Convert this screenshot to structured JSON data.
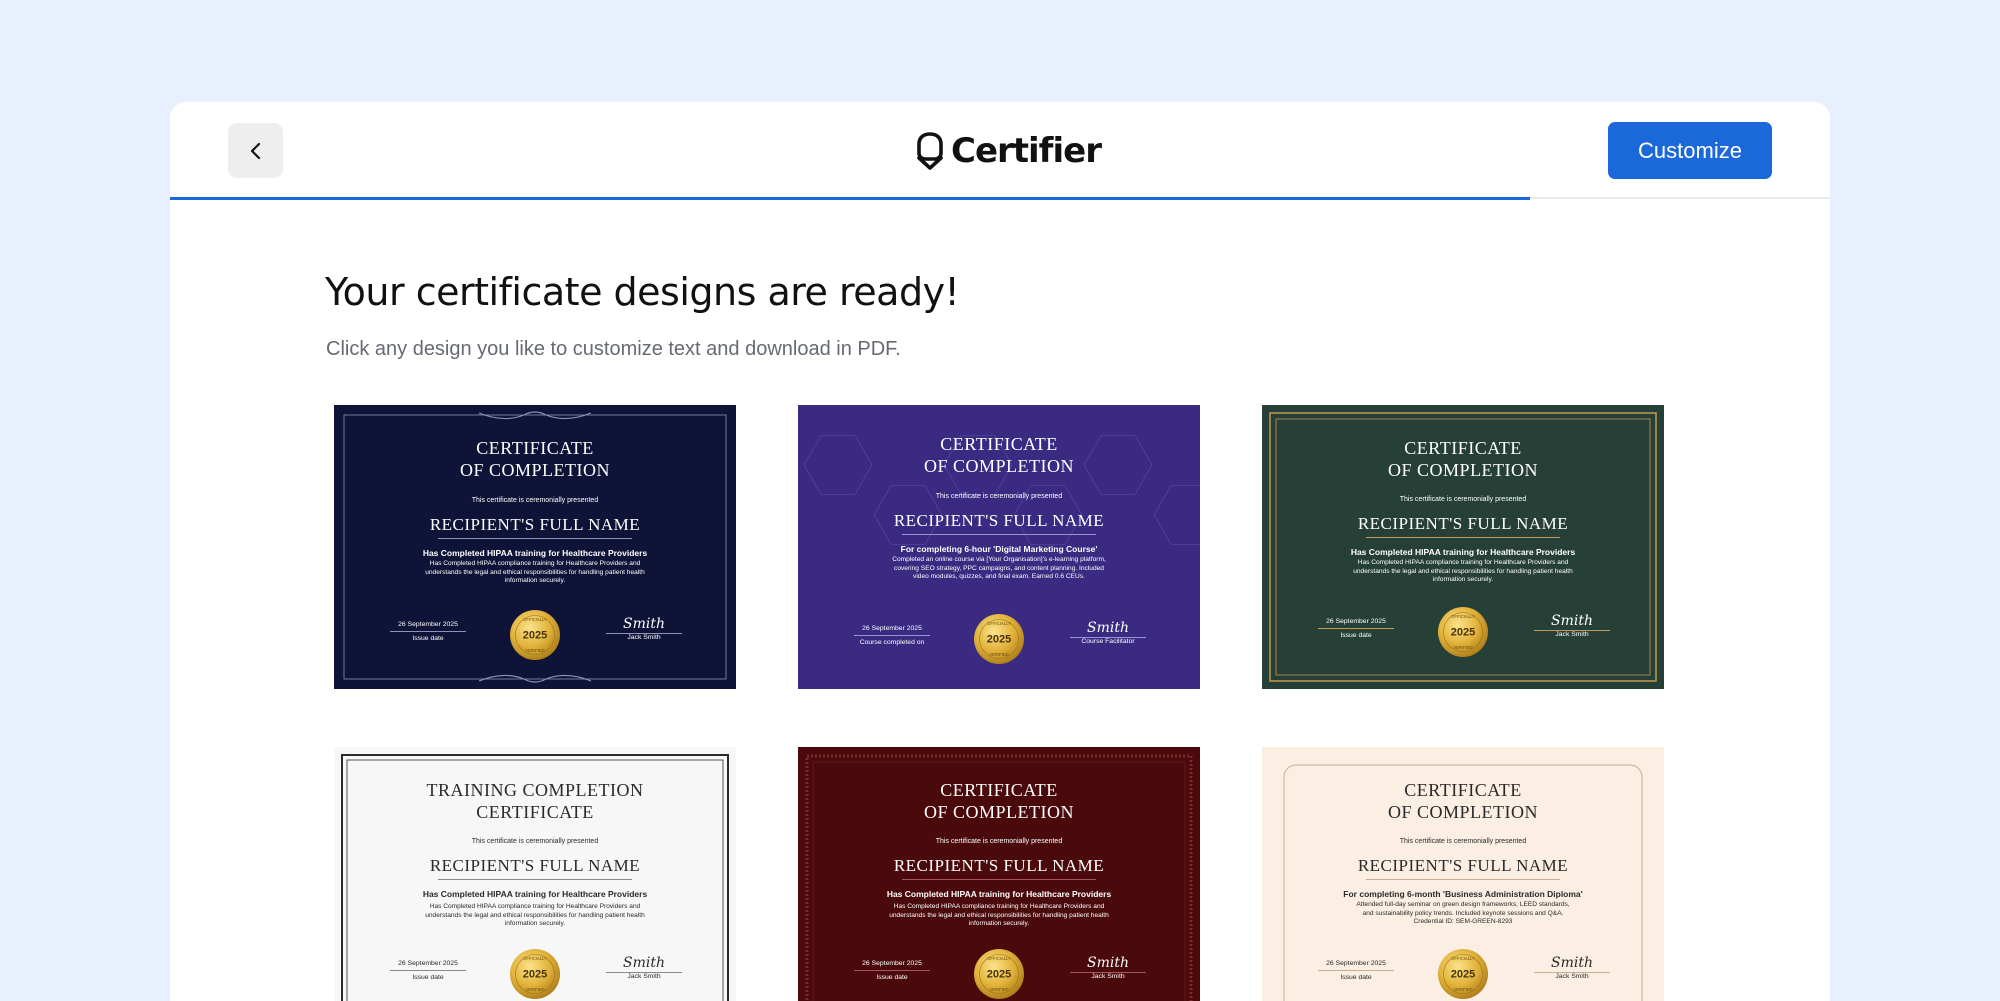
{
  "header": {
    "back_icon": "chevron-left-icon",
    "logo_icon": "certifier-shield-icon",
    "logo_text": "Certifier",
    "customize_label": "Customize",
    "progress_fraction": 0.819
  },
  "main": {
    "title": "Your certificate designs are ready!",
    "subtitle": "Click any design you like to customize text and download in PDF."
  },
  "seal": {
    "top_text": "OFFICIALLY",
    "year": "2025",
    "bottom_text": "VERIFIED"
  },
  "certificates": [
    {
      "title_line1": "CERTIFICATE",
      "title_line2": "OF COMPLETION",
      "presented": "This certificate is ceremonially presented",
      "name": "RECIPIENT'S FULL NAME",
      "course": "Has Completed HIPAA training for Healthcare Providers",
      "description": "Has Completed HIPAA compliance training for Healthcare Providers and understands the legal and ethical responsibilities for handling patient health information securely.",
      "date": "26 September 2025",
      "date_label": "Issue date",
      "signature": "Smith",
      "signer": "Jack Smith",
      "background": "#0f1338",
      "text_color": "#ffffff",
      "accent": "#8d92b8"
    },
    {
      "title_line1": "CERTIFICATE",
      "title_line2": "OF COMPLETION",
      "presented": "This certificate is ceremonially presented",
      "name": "RECIPIENT'S FULL NAME",
      "course": "For completing 6-hour 'Digital Marketing Course'",
      "description": "Completed an online course via [Your Organisation]'s e-learning platform, covering SEO strategy, PPC campaigns, and content planning. Included video modules, quizzes, and final exam. Earned 0.6 CEUs.",
      "date": "26 September 2025",
      "date_label": "Course completed on",
      "signature": "Smith",
      "signer": "Course Facilitator",
      "background": "#3a2a82",
      "text_color": "#ffffff",
      "accent": "#9c90d6"
    },
    {
      "title_line1": "CERTIFICATE",
      "title_line2": "OF COMPLETION",
      "presented": "This certificate is ceremonially presented",
      "name": "RECIPIENT'S FULL NAME",
      "course": "Has Completed HIPAA training for Healthcare Providers",
      "description": "Has Completed HIPAA compliance training for Healthcare Providers and understands the legal and ethical responsibilities for handling patient health information securely.",
      "date": "26 September 2025",
      "date_label": "Issue date",
      "signature": "Smith",
      "signer": "Jack Smith",
      "background": "#263f37",
      "text_color": "#ffffff",
      "accent": "#c49a52"
    },
    {
      "title_line1": "TRAINING COMPLETION",
      "title_line2": "CERTIFICATE",
      "presented": "This certificate is ceremonially presented",
      "name": "RECIPIENT'S FULL NAME",
      "course": "Has Completed HIPAA training for Healthcare Providers",
      "description": "Has Completed HIPAA compliance training for Healthcare Providers and understands the legal and ethical responsibilities for handling patient health information securely.",
      "date": "26 September 2025",
      "date_label": "Issue date",
      "signature": "Smith",
      "signer": "Jack Smith",
      "background": "#f7f7f7",
      "text_color": "#2a2a2a",
      "accent": "#8a8a8a"
    },
    {
      "title_line1": "CERTIFICATE",
      "title_line2": "OF COMPLETION",
      "presented": "This certificate is ceremonially presented",
      "name": "RECIPIENT'S FULL NAME",
      "course": "Has Completed HIPAA training for Healthcare Providers",
      "description": "Has Completed HIPAA compliance training for Healthcare Providers and understands the legal and ethical responsibilities for handling patient health information securely.",
      "date": "26 September 2025",
      "date_label": "Issue date",
      "signature": "Smith",
      "signer": "Jack Smith",
      "background": "#4a0a0c",
      "text_color": "#ffffff",
      "accent": "#a5575a"
    },
    {
      "title_line1": "CERTIFICATE",
      "title_line2": "OF COMPLETION",
      "presented": "This certificate is ceremonially presented",
      "name": "RECIPIENT'S FULL NAME",
      "course": "For completing 6-month 'Business Administration Diploma'",
      "description": "Attended full-day seminar on green design frameworks, LEED standards, and sustainability policy trends. Included keynote sessions and Q&A. Credential ID: SEM-GREEN-8293",
      "date": "26 September 2025",
      "date_label": "Issue date",
      "signature": "Smith",
      "signer": "Jack Smith",
      "background": "#fbeee2",
      "text_color": "#2a2a2a",
      "accent": "#c9ad96"
    }
  ]
}
